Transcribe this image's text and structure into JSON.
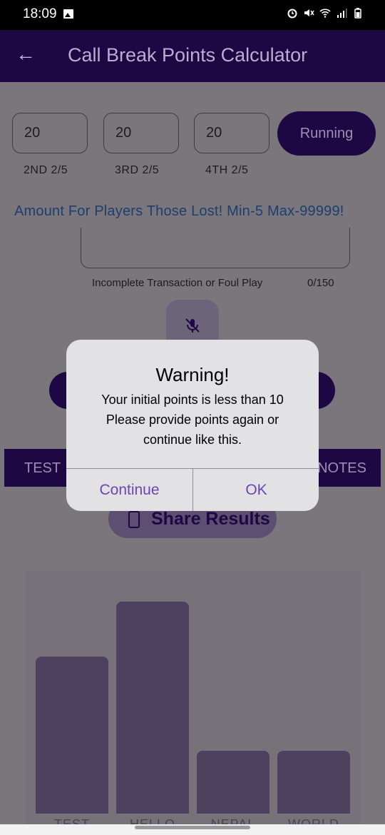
{
  "status_bar": {
    "time": "18:09",
    "icons": [
      "image-icon",
      "alarm-icon",
      "mute-icon",
      "wifi-icon",
      "signal-icon",
      "battery-icon"
    ]
  },
  "app_bar": {
    "title": "Call Break Points Calculator",
    "back_icon": "arrow-left-icon"
  },
  "players": [
    {
      "value": "20",
      "label": "2ND  2/5"
    },
    {
      "value": "20",
      "label": "3RD  2/5"
    },
    {
      "value": "20",
      "label": "4TH  2/5"
    }
  ],
  "running_button": "Running",
  "amount_text": "Amount For Players Those Lost! Min-5 Max-99999!",
  "note": {
    "label": "Incomplete Transaction or Foul Play",
    "counter": "0/150"
  },
  "tabs": {
    "left": "TEST",
    "right": "NOTES"
  },
  "share_button": "Share Results",
  "chart_data": {
    "type": "bar",
    "categories": [
      "TEST",
      "HELLO",
      "NEPAL",
      "WORLD"
    ],
    "values": [
      20,
      27,
      8,
      8
    ],
    "ylim": [
      0,
      30
    ],
    "grid": false
  },
  "dialog": {
    "title": "Warning!",
    "message": "Your initial points is less than 10 Please provide points again or continue like this.",
    "continue_label": "Continue",
    "ok_label": "OK"
  },
  "colors": {
    "primary": "#1e0843",
    "overlay": "#7a767c",
    "dialog_button": "#6946b0"
  }
}
